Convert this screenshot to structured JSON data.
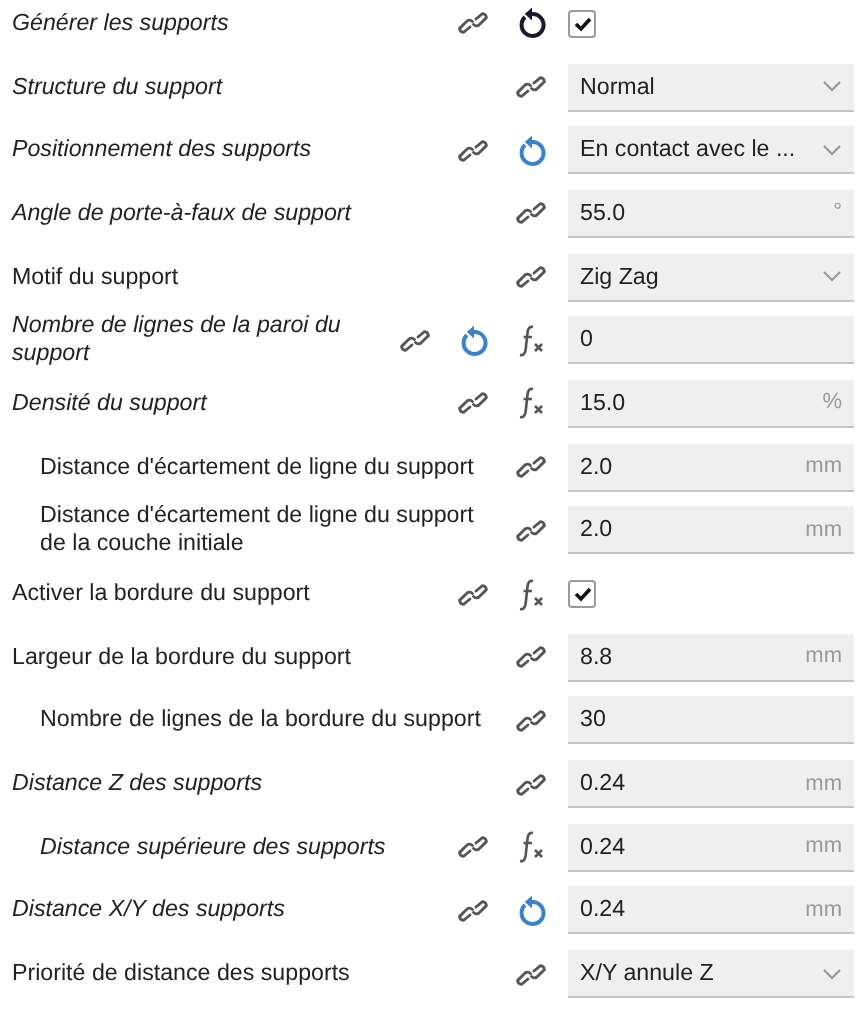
{
  "settings": [
    {
      "label": "Générer les supports",
      "italic": true,
      "reset": {
        "color": "#1a1a2e"
      },
      "formula": false,
      "control": {
        "kind": "checkbox",
        "checked": true
      }
    },
    {
      "label": "Structure du support",
      "italic": true,
      "formula": false,
      "control": {
        "kind": "dropdown",
        "value": "Normal"
      }
    },
    {
      "label": "Positionnement des supports",
      "italic": true,
      "reset": {
        "color": "#3a82d0"
      },
      "formula": false,
      "control": {
        "kind": "dropdown",
        "value": "En contact avec le ..."
      }
    },
    {
      "label": "Angle de porte-à-faux de support",
      "italic": true,
      "formula": false,
      "control": {
        "kind": "number",
        "value": "55.0",
        "unit": "°"
      }
    },
    {
      "label": "Motif du support",
      "italic": false,
      "formula": false,
      "control": {
        "kind": "dropdown",
        "value": "Zig Zag"
      }
    },
    {
      "label": "Nombre de lignes de la paroi du support",
      "italic": true,
      "reset": {
        "color": "#3a82d0"
      },
      "formula": true,
      "control": {
        "kind": "number",
        "value": "0"
      }
    },
    {
      "label": "Densité du support",
      "italic": true,
      "formula": true,
      "control": {
        "kind": "number",
        "value": "15.0",
        "unit": "%"
      },
      "children": [
        {
          "label": "Distance d'écartement de ligne du support",
          "italic": false,
          "formula": false,
          "control": {
            "kind": "number",
            "value": "2.0",
            "unit": "mm"
          }
        },
        {
          "label": "Distance d'écartement de ligne du support de la couche initiale",
          "italic": false,
          "formula": false,
          "control": {
            "kind": "number",
            "value": "2.0",
            "unit": "mm"
          }
        }
      ]
    },
    {
      "label": "Activer la bordure du support",
      "italic": false,
      "formula": true,
      "control": {
        "kind": "checkbox",
        "checked": true
      }
    },
    {
      "label": "Largeur de la bordure du support",
      "italic": false,
      "formula": false,
      "control": {
        "kind": "number",
        "value": "8.8",
        "unit": "mm"
      },
      "children": [
        {
          "label": "Nombre de lignes de la bordure du support",
          "italic": false,
          "formula": false,
          "control": {
            "kind": "number",
            "value": "30"
          }
        }
      ]
    },
    {
      "label": "Distance Z des supports",
      "italic": true,
      "formula": false,
      "control": {
        "kind": "number",
        "value": "0.24",
        "unit": "mm"
      },
      "children": [
        {
          "label": "Distance supérieure des supports",
          "italic": true,
          "formula": true,
          "control": {
            "kind": "number",
            "value": "0.24",
            "unit": "mm"
          }
        }
      ]
    },
    {
      "label": "Distance X/Y des supports",
      "italic": true,
      "reset": {
        "color": "#3a82d0"
      },
      "formula": false,
      "control": {
        "kind": "number",
        "value": "0.24",
        "unit": "mm"
      }
    },
    {
      "label": "Priorité de distance des supports",
      "italic": false,
      "formula": false,
      "control": {
        "kind": "dropdown",
        "value": "X/Y annule Z"
      }
    }
  ]
}
